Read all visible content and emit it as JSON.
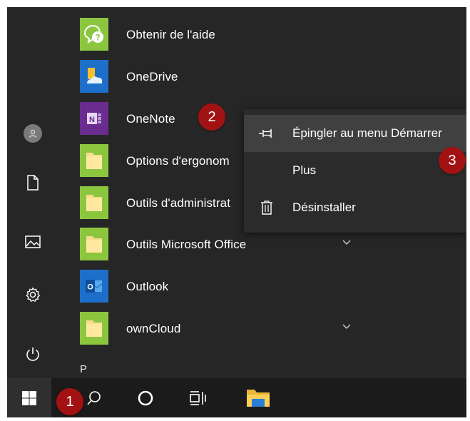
{
  "rail": {
    "items": [
      {
        "name": "user-avatar",
        "icon": "user-icon"
      },
      {
        "name": "documents",
        "icon": "document-icon"
      },
      {
        "name": "pictures",
        "icon": "picture-icon"
      },
      {
        "name": "settings",
        "icon": "gear-icon"
      },
      {
        "name": "power",
        "icon": "power-icon"
      }
    ]
  },
  "apps": [
    {
      "label": "Obtenir de l'aide",
      "icon": "help-icon",
      "tile_color": "#8cc63f",
      "expandable": false
    },
    {
      "label": "OneDrive",
      "icon": "onedrive-icon",
      "tile_color": "#1e6fc9",
      "expandable": false
    },
    {
      "label": "OneNote",
      "icon": "onenote-icon",
      "tile_color": "#6b2c8f",
      "expandable": false
    },
    {
      "label": "Options d'ergonom",
      "icon": "folder-icon",
      "tile_color": "#8cc63f",
      "expandable": false
    },
    {
      "label": "Outils d'administrat",
      "icon": "folder-icon",
      "tile_color": "#8cc63f",
      "expandable": false
    },
    {
      "label": "Outils Microsoft Office",
      "icon": "folder-icon",
      "tile_color": "#8cc63f",
      "expandable": true
    },
    {
      "label": "Outlook",
      "icon": "outlook-icon",
      "tile_color": "#1e6fc9",
      "expandable": false
    },
    {
      "label": "ownCloud",
      "icon": "folder-icon",
      "tile_color": "#8cc63f",
      "expandable": true
    }
  ],
  "section_letter": "P",
  "context_menu": {
    "items": [
      {
        "label": "Épingler au menu Démarrer",
        "icon": "pin-icon",
        "highlighted": true
      },
      {
        "label": "Plus",
        "icon": "",
        "highlighted": false
      },
      {
        "label": "Désinstaller",
        "icon": "trash-icon",
        "highlighted": false
      }
    ]
  },
  "taskbar": {
    "items": [
      {
        "name": "start",
        "icon": "windows-icon"
      },
      {
        "name": "search",
        "icon": "search-icon"
      },
      {
        "name": "cortana",
        "icon": "cortana-icon"
      },
      {
        "name": "task-view",
        "icon": "task-view-icon"
      },
      {
        "name": "file-explorer",
        "icon": "file-explorer-icon"
      }
    ]
  },
  "badges": [
    "1",
    "2",
    "3"
  ],
  "colors": {
    "menu_bg": "#262626",
    "taskbar_bg": "#1b1b1b",
    "context_bg": "#2b2b2b",
    "highlight": "#404040",
    "badge": "#a31212"
  }
}
